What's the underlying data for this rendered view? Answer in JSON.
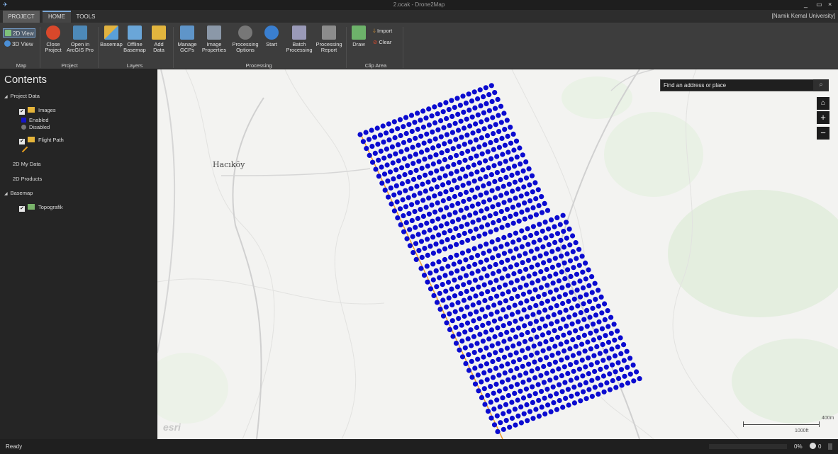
{
  "window": {
    "title": "2.ocak - Drone2Map",
    "app_icon": "drone2map-icon",
    "controls": [
      "_",
      "▭",
      "×"
    ]
  },
  "tabs": {
    "project": "PROJECT",
    "home": "HOME",
    "tools": "TOOLS",
    "user": "[Namik Kemal University]"
  },
  "ribbon": {
    "map": {
      "view2d": "2D View",
      "view3d": "3D View",
      "group": "Map"
    },
    "project": {
      "close": "Close\nProject",
      "open_arcgis": "Open in\nArcGIS Pro",
      "group": "Project"
    },
    "layers": {
      "basemap": "Basemap",
      "offline": "Offline\nBasemap",
      "add_data": "Add\nData",
      "group": "Layers"
    },
    "processing": {
      "manage_gcps": "Manage\nGCPs",
      "image_props": "Image\nProperties",
      "proc_options": "Processing\nOptions",
      "start": "Start",
      "batch": "Batch\nProcessing",
      "report": "Processing\nReport",
      "group": "Processing"
    },
    "clip": {
      "draw": "Draw",
      "import": "Import",
      "clear": "Clear",
      "group": "Clip Area"
    }
  },
  "contents": {
    "title": "Contents",
    "project_data": "Project Data",
    "images": "Images",
    "enabled": "Enabled",
    "disabled": "Disabled",
    "flight_path": "Flight Path",
    "my_data": "2D My Data",
    "products": "2D Products",
    "basemap": "Basemap",
    "topo": "Topografik",
    "colors": {
      "enabled": "#1515c8",
      "disabled": "#777777",
      "flight": "#e8a020"
    }
  },
  "map": {
    "search_placeholder": "Find an address or place",
    "place_label": "Hacıköy",
    "logo": "esri",
    "scale_top": "400m",
    "scale_bottom": "1000ft",
    "home_icon": "home-icon",
    "zoom_in": "+",
    "zoom_out": "−",
    "point_color": "#0b0bd0",
    "line_color": "#f0a030"
  },
  "status": {
    "ready": "Ready",
    "percent": "0%",
    "count": "0"
  }
}
